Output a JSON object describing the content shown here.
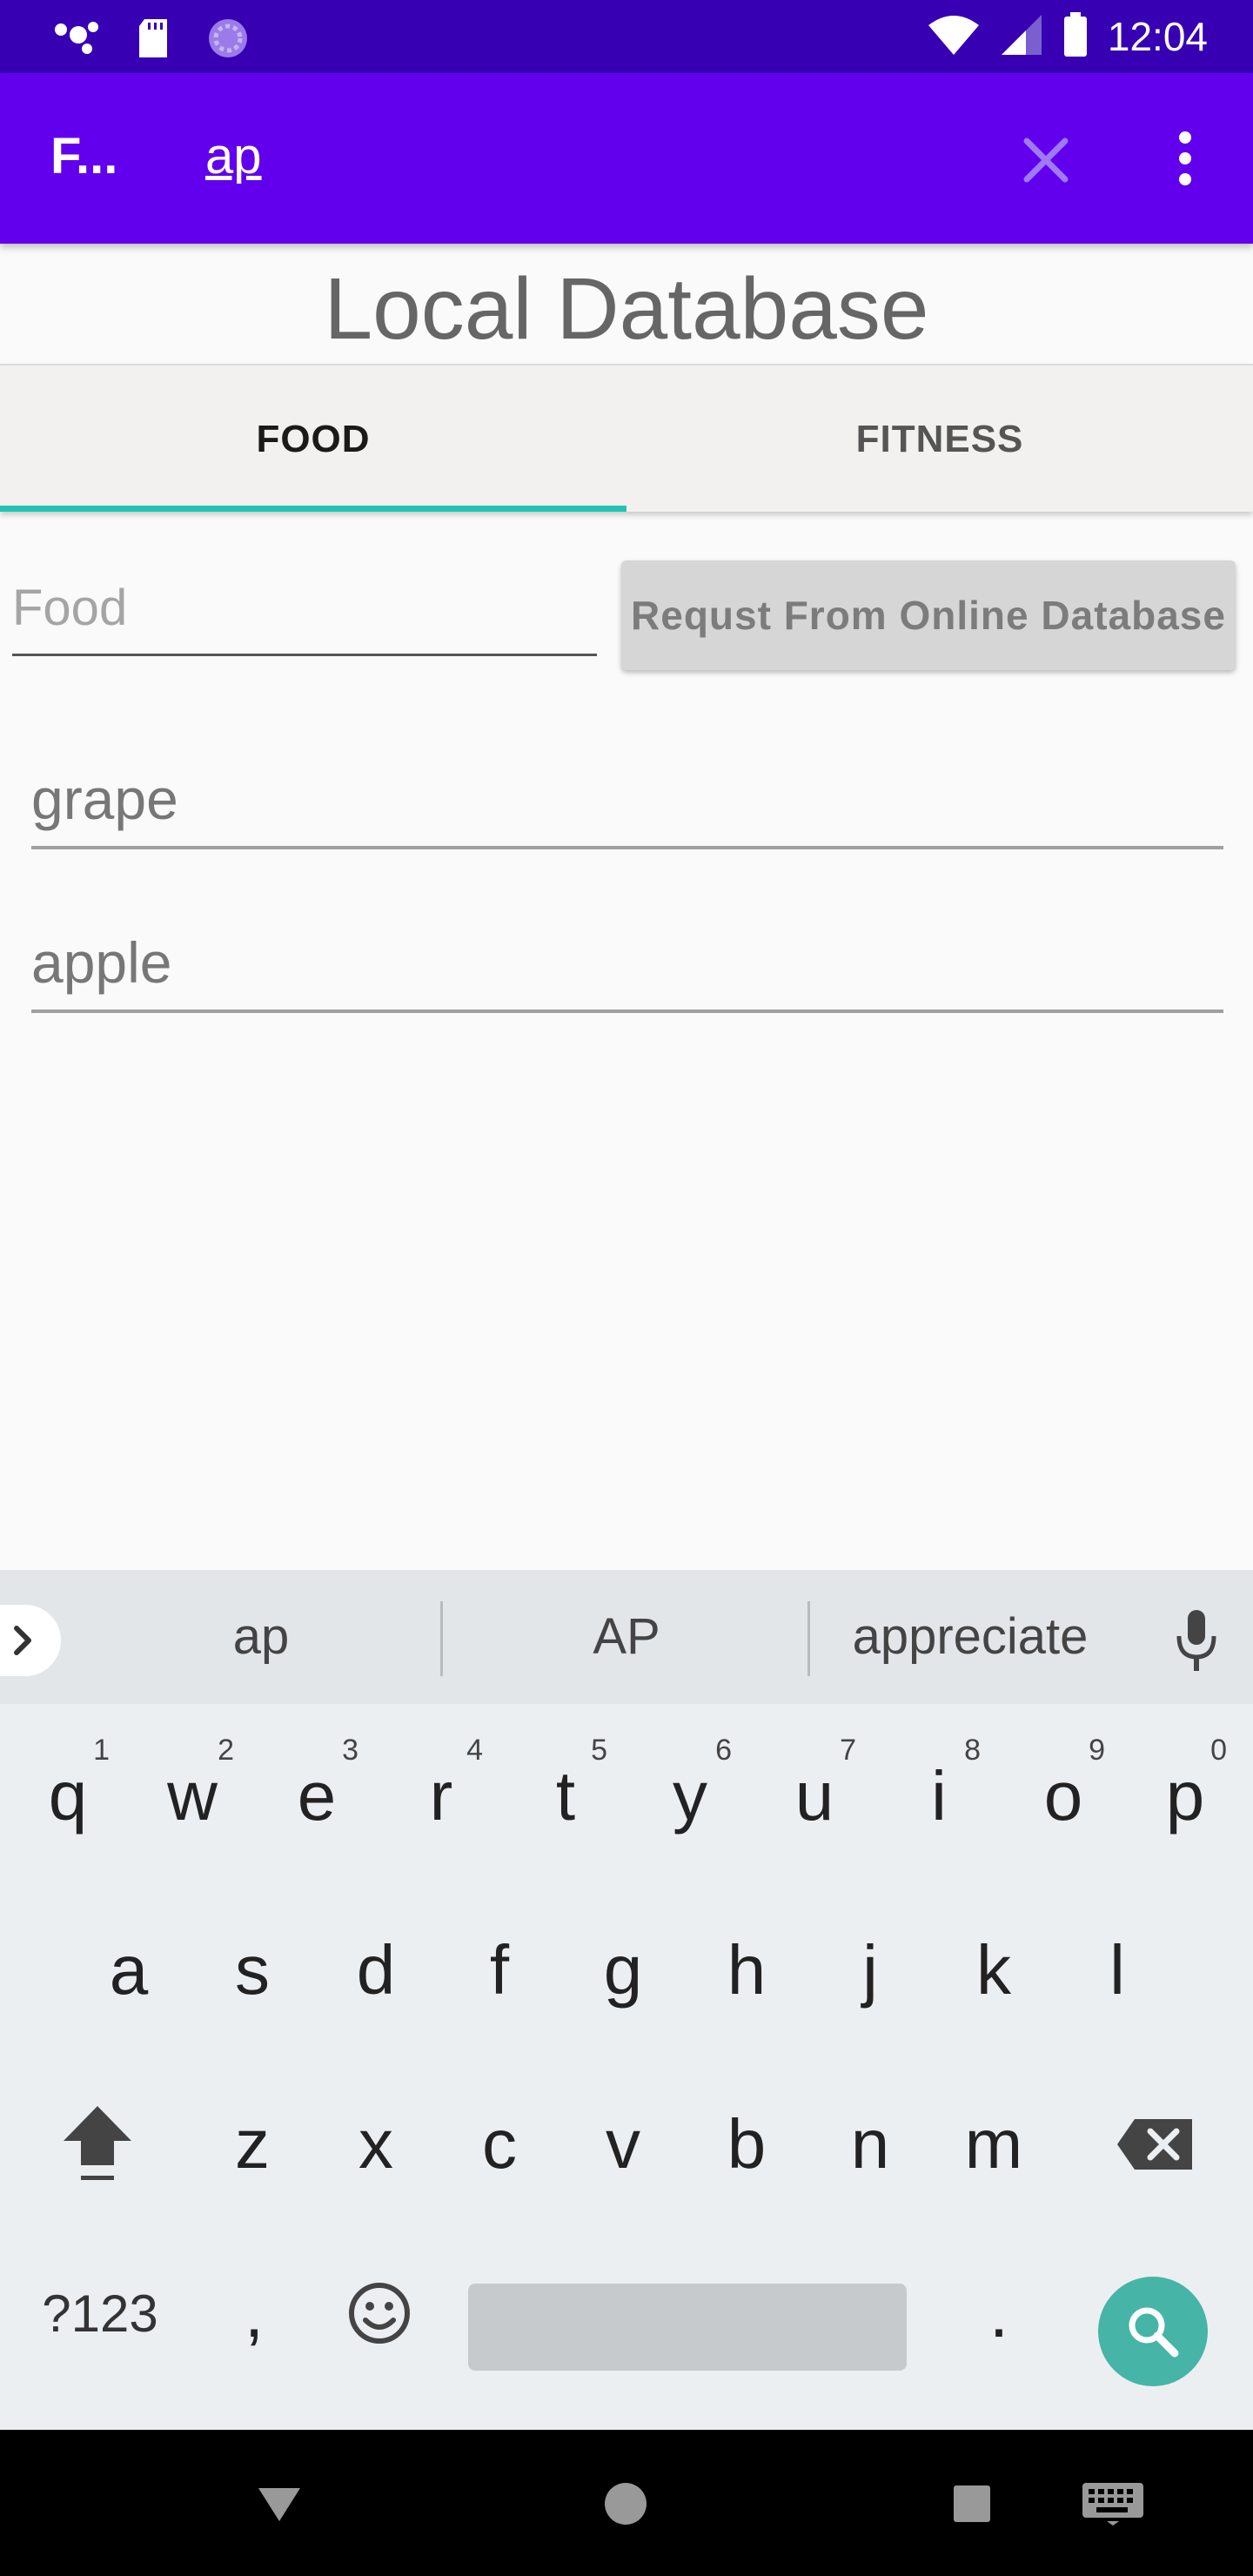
{
  "status_bar": {
    "time": "12:04",
    "icons": [
      "assistant-icon",
      "sd-card-icon",
      "sync-icon",
      "wifi-icon",
      "signal-icon",
      "battery-icon"
    ]
  },
  "app_bar": {
    "title": "F...",
    "search_query": "ap",
    "clear_icon": "close-icon",
    "overflow_icon": "more-vert-icon",
    "background": "#6200ee"
  },
  "page": {
    "title": "Local Database"
  },
  "tabs": [
    {
      "label": "FOOD",
      "selected": true
    },
    {
      "label": "FITNESS",
      "selected": false
    }
  ],
  "food_search": {
    "placeholder": "Food",
    "value": "",
    "request_button_label": "Requst From Online Database"
  },
  "results": [
    "grape",
    "apple"
  ],
  "keyboard": {
    "suggestions": [
      "ap",
      "AP",
      "appreciate"
    ],
    "row1": [
      {
        "key": "q",
        "hint": "1"
      },
      {
        "key": "w",
        "hint": "2"
      },
      {
        "key": "e",
        "hint": "3"
      },
      {
        "key": "r",
        "hint": "4"
      },
      {
        "key": "t",
        "hint": "5"
      },
      {
        "key": "y",
        "hint": "6"
      },
      {
        "key": "u",
        "hint": "7"
      },
      {
        "key": "i",
        "hint": "8"
      },
      {
        "key": "o",
        "hint": "9"
      },
      {
        "key": "p",
        "hint": "0"
      }
    ],
    "row2": [
      "a",
      "s",
      "d",
      "f",
      "g",
      "h",
      "j",
      "k",
      "l"
    ],
    "row3": [
      "z",
      "x",
      "c",
      "v",
      "b",
      "n",
      "m"
    ],
    "symbols_label": "?123",
    "comma": ",",
    "period": ".",
    "action_color": "#46b4a6"
  },
  "nav_bar": {
    "icons": [
      "back-icon",
      "home-icon",
      "recents-icon",
      "keyboard-icon"
    ]
  }
}
